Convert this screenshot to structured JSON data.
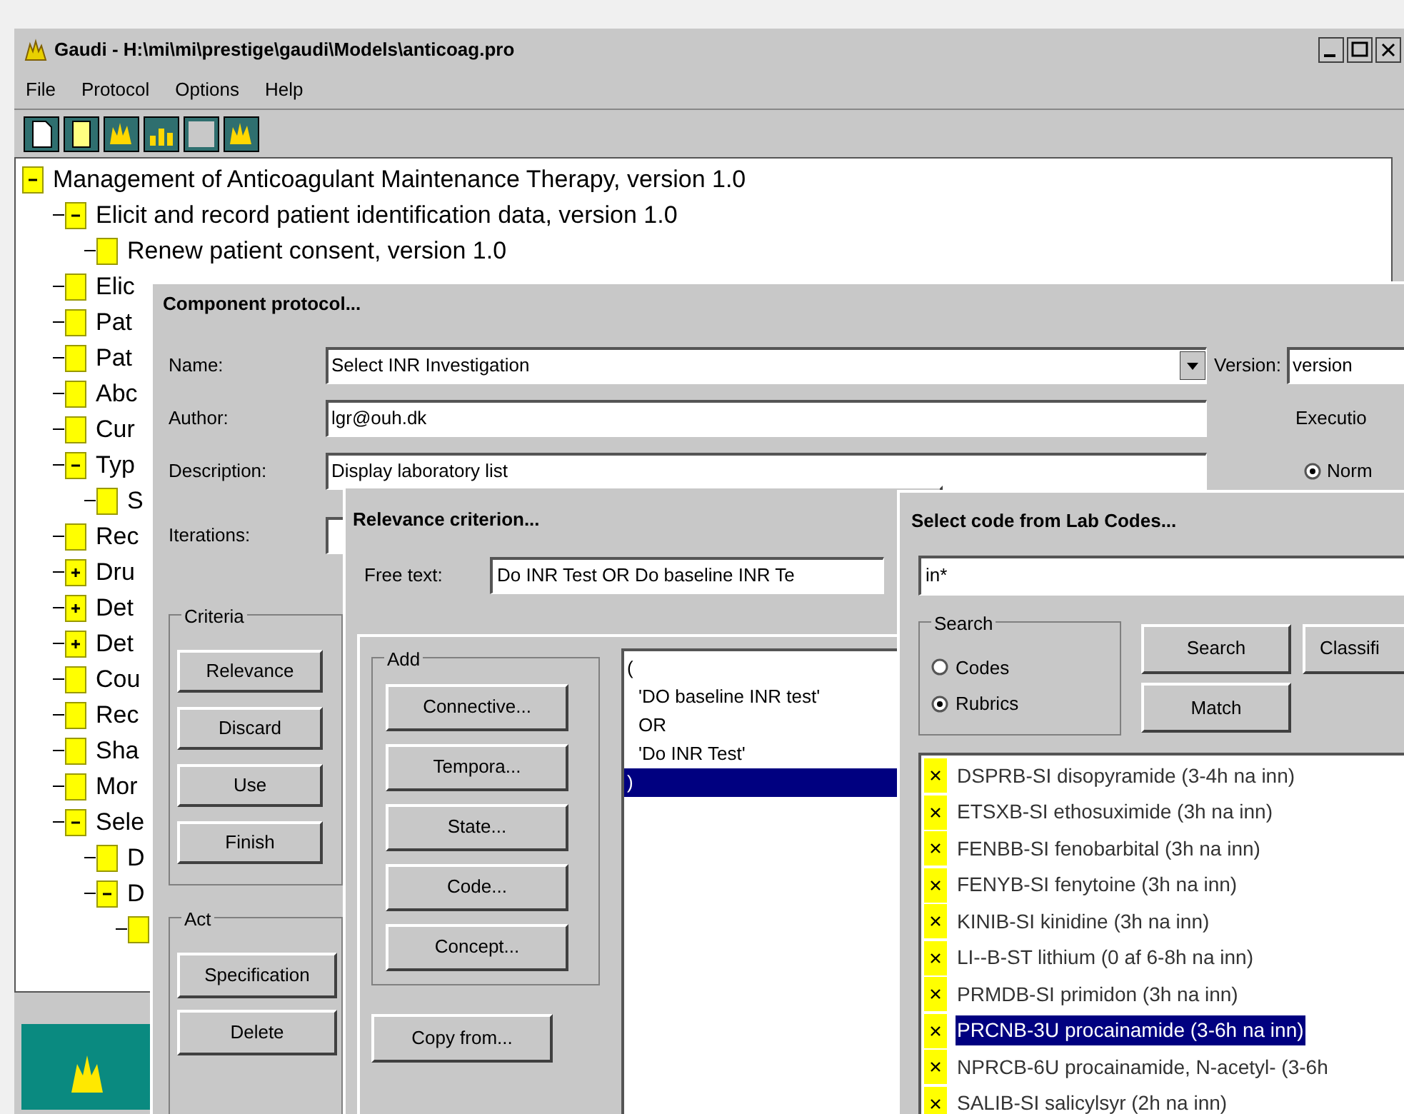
{
  "window": {
    "title": "Gaudi - H:\\mi\\mi\\prestige\\gaudi\\Models\\anticoag.pro"
  },
  "menu": [
    "File",
    "Protocol",
    "Options",
    "Help"
  ],
  "tree": [
    {
      "label": "Management of Anticoagulant Maintenance Therapy, version 1.0",
      "expanded": true,
      "children": [
        {
          "label": "Elicit and record patient identification data, version 1.0",
          "expanded": true,
          "children": [
            {
              "label": "Renew patient consent, version 1.0"
            }
          ]
        },
        {
          "label": "Elic"
        },
        {
          "label": "Pat"
        },
        {
          "label": "Pat"
        },
        {
          "label": "Abc"
        },
        {
          "label": "Cur"
        },
        {
          "label": "Typ",
          "expanded": true,
          "children": [
            {
              "label": "S"
            }
          ]
        },
        {
          "label": "Rec"
        },
        {
          "label": "Dru",
          "expanded": false
        },
        {
          "label": "Det",
          "expanded": false
        },
        {
          "label": "Det",
          "expanded": false
        },
        {
          "label": "Cou"
        },
        {
          "label": "Rec"
        },
        {
          "label": "Sha"
        },
        {
          "label": "Mor"
        },
        {
          "label": "Sele",
          "expanded": true,
          "children": [
            {
              "label": "D"
            },
            {
              "label": "D",
              "expanded": true,
              "children": [
                {
                  "kind": "leaf"
                }
              ]
            }
          ]
        }
      ]
    }
  ],
  "component_dialog": {
    "title": "Component protocol...",
    "name": {
      "label": "Name:",
      "value": "Select INR Investigation"
    },
    "version": {
      "label": "Version:",
      "value": "version"
    },
    "author": {
      "label": "Author:",
      "value": "lgr@ouh.dk"
    },
    "description": {
      "label": "Description:",
      "value": "Display laboratory list"
    },
    "execution": {
      "title": "Executio",
      "option": {
        "label": "Norm",
        "selected": true
      }
    },
    "iterations": {
      "label": "Iterations:"
    },
    "criteria": {
      "title": "Criteria",
      "buttons": [
        "Relevance",
        "Discard",
        "Use",
        "Finish"
      ]
    },
    "act": {
      "title": "Act",
      "buttons": [
        "Specification",
        "Delete"
      ]
    }
  },
  "relevance_dialog": {
    "title": "Relevance criterion...",
    "free_text": {
      "label": "Free text:",
      "value": "Do INR Test OR Do baseline INR Te"
    },
    "add": {
      "title": "Add",
      "buttons": [
        "Connective...",
        "Tempora...",
        "State...",
        "Code...",
        "Concept..."
      ]
    },
    "copy_button": "Copy from...",
    "expression": [
      {
        "text": "(",
        "selected": false
      },
      {
        "text": "'DO baseline INR test'",
        "selected": false
      },
      {
        "text": "OR",
        "selected": false
      },
      {
        "text": "'Do INR Test'",
        "selected": false
      },
      {
        "text": ")",
        "selected": true
      }
    ]
  },
  "lab_codes_dialog": {
    "title": "Select code from Lab Codes...",
    "query": "in*",
    "search_group": {
      "title": "Search",
      "options": [
        {
          "label": "Codes",
          "selected": false
        },
        {
          "label": "Rubrics",
          "selected": true
        }
      ]
    },
    "buttons": [
      "Search",
      "Match",
      "Classifi"
    ],
    "codes": [
      {
        "text": "DSPRB-SI disopyramide (3-4h na inn)",
        "selected": false
      },
      {
        "text": "ETSXB-SI ethosuximide (3h na inn)",
        "selected": false
      },
      {
        "text": "FENBB-SI fenobarbital (3h na inn)",
        "selected": false
      },
      {
        "text": "FENYB-SI fenytoine (3h na inn)",
        "selected": false
      },
      {
        "text": "KINIB-SI kinidine (3h na inn)",
        "selected": false
      },
      {
        "text": "LI--B-ST lithium (0 af 6-8h na inn)",
        "selected": false
      },
      {
        "text": "PRMDB-SI primidon (3h na inn)",
        "selected": false
      },
      {
        "text": "PRCNB-3U procainamide (3-6h na inn)",
        "selected": true
      },
      {
        "text": "NPRCB-6U procainamide, N-acetyl- (3-6h",
        "selected": false
      },
      {
        "text": "SALIB-SI salicylsyr (2h na inn)",
        "selected": false
      }
    ]
  }
}
